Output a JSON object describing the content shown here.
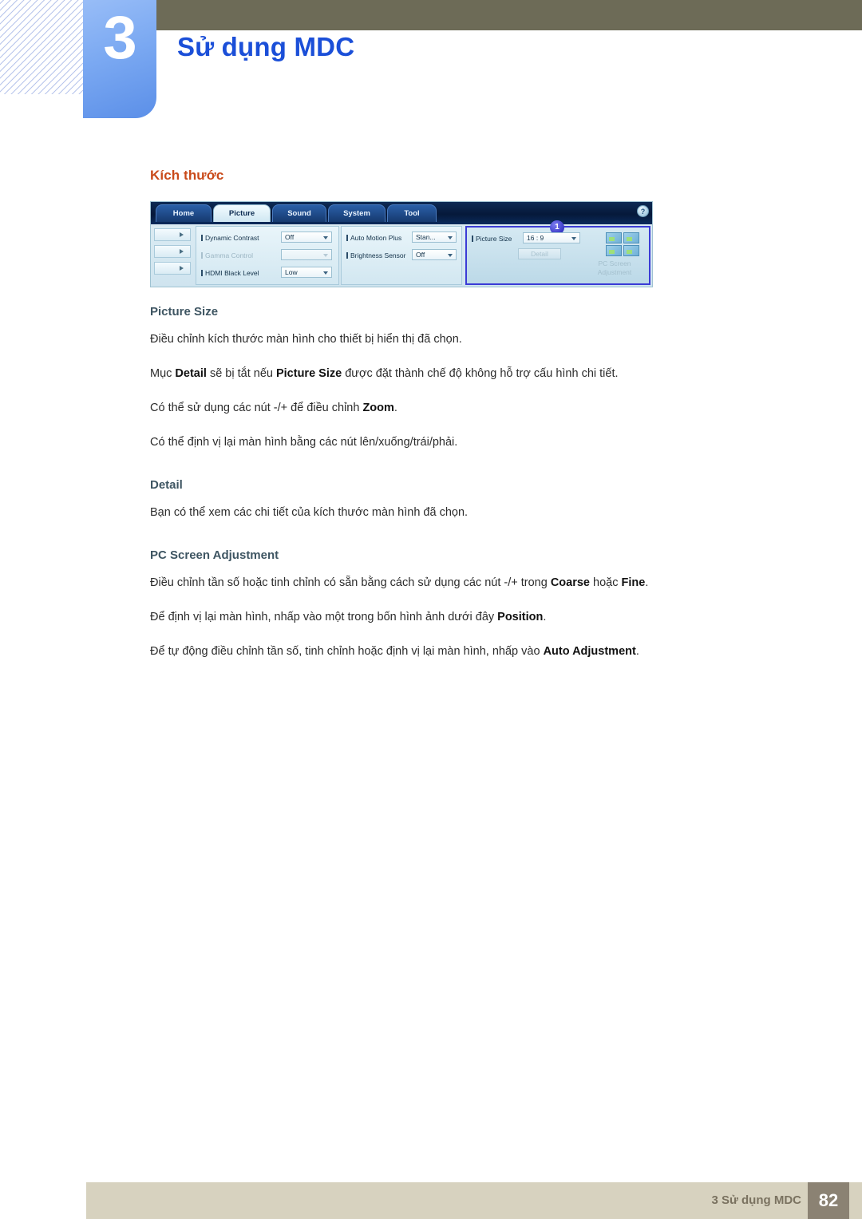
{
  "header": {
    "chapter_number": "3",
    "chapter_title": "Sử dụng MDC"
  },
  "content": {
    "section_heading": "Kích thước",
    "blocks": [
      {
        "heading": "Picture Size"
      },
      {
        "text": "Điều chỉnh kích thước màn hình cho thiết bị hiển thị đã chọn."
      },
      {
        "text": "Mục Detail sẽ bị tắt nếu Picture Size được đặt thành chế độ không hỗ trợ cấu hình chi tiết."
      },
      {
        "text": "Có thể sử dụng các nút -/+ để điều chỉnh Zoom."
      },
      {
        "text": "Có thể định vị lại màn hình bằng các nút lên/xuống/trái/phải."
      },
      {
        "heading": "Detail"
      },
      {
        "text": "Bạn có thể xem các chi tiết của kích thước màn hình đã chọn."
      },
      {
        "heading": "PC Screen Adjustment"
      },
      {
        "text": "Điều chỉnh tần số hoặc tinh chỉnh có sẵn bằng cách sử dụng các nút -/+ trong Coarse hoặc Fine."
      },
      {
        "text": "Để định vị lại màn hình, nhấp vào một trong bốn hình ảnh dưới đây Position."
      },
      {
        "text": "Để tự động điều chỉnh tần số, tinh chỉnh hoặc định vị lại màn hình, nhấp vào Auto Adjustment."
      }
    ],
    "paragraphs": {
      "p1": "Điều chỉnh kích thước màn hình cho thiết bị hiển thị đã chọn.",
      "p2_a": "Mục ",
      "p2_b": "Detail",
      "p2_c": " sẽ bị tắt nếu ",
      "p2_d": "Picture Size",
      "p2_e": " được đặt thành chế độ không hỗ trợ cấu hình chi tiết.",
      "p3_a": "Có thể sử dụng các nút -/+ để điều chỉnh ",
      "p3_b": "Zoom",
      "p3_c": ".",
      "p4": "Có thể định vị lại màn hình bằng các nút lên/xuống/trái/phải.",
      "p5": "Bạn có thể xem các chi tiết của kích thước màn hình đã chọn.",
      "p6_a": "Điều chỉnh tần số hoặc tinh chỉnh có sẵn bằng cách sử dụng các nút -/+ trong ",
      "p6_b": "Coarse",
      "p6_c": " hoặc ",
      "p6_d": "Fine",
      "p6_e": ".",
      "p7_a": "Để định vị lại màn hình, nhấp vào một trong bốn hình ảnh dưới đây ",
      "p7_b": "Position",
      "p7_c": ".",
      "p8_a": "Để tự động điều chỉnh tần số, tinh chỉnh hoặc định vị lại màn hình, nhấp vào ",
      "p8_b": "Auto Adjustment",
      "p8_c": "."
    },
    "headings": {
      "picture_size": "Picture Size",
      "detail": "Detail",
      "pc_screen_adjustment": "PC Screen Adjustment"
    }
  },
  "mdc_screenshot": {
    "tabs": [
      {
        "label": "Home",
        "active": false
      },
      {
        "label": "Picture",
        "active": true
      },
      {
        "label": "Sound",
        "active": false
      },
      {
        "label": "System",
        "active": false
      },
      {
        "label": "Tool",
        "active": false
      }
    ],
    "help_glyph": "?",
    "group_left": [
      {
        "label": "Dynamic Contrast",
        "value": "Off",
        "disabled": false
      },
      {
        "label": "Gamma Control",
        "value": "",
        "disabled": true
      },
      {
        "label": "HDMI Black Level",
        "value": "Low",
        "disabled": false
      }
    ],
    "group_mid": [
      {
        "label": "Auto Motion Plus",
        "value": "Stan...",
        "disabled": false
      },
      {
        "label": "Brightness Sensor",
        "value": "Off",
        "disabled": false
      }
    ],
    "group_right": {
      "label": "Picture Size",
      "value": "16 : 9",
      "detail_button": "Detail",
      "pc_screen_label_line1": "PC Screen",
      "pc_screen_label_line2": "Adjustment",
      "callout_badge": "1"
    }
  },
  "footer": {
    "text": "3 Sử dụng MDC",
    "page": "82"
  },
  "colors": {
    "accent_orange": "#c94a1a",
    "title_blue": "#1b4fd8",
    "chapter_tab_blue": "#7ba9f2",
    "olive_bar": "#6d6b57",
    "footer_bar": "#d7d2bf",
    "footer_page_block": "#8b8273",
    "subheading_slate": "#3e5562"
  }
}
